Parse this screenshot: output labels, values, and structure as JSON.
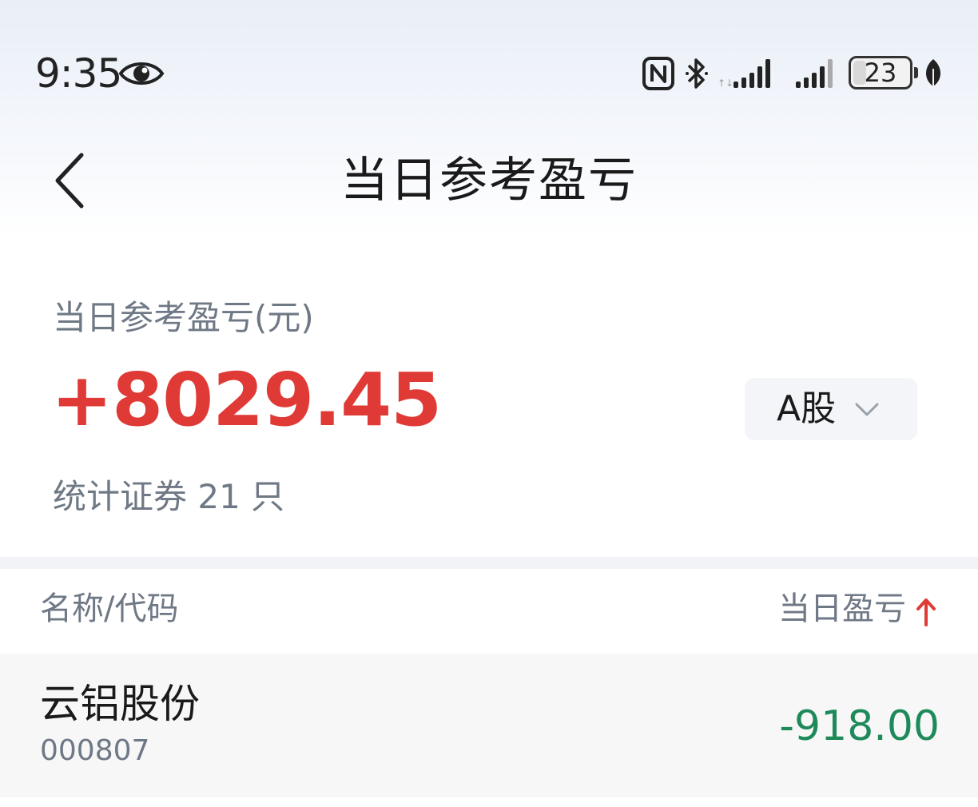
{
  "status_bar": {
    "time": "9:35",
    "battery_level": "23",
    "battery_fraction": 0.23,
    "icons": [
      "eye-icon",
      "nfc-icon",
      "bluetooth-icon",
      "signal-icon",
      "signal-icon",
      "battery-icon",
      "leaf-icon"
    ]
  },
  "nav": {
    "title": "当日参考盈亏",
    "back_icon": "chevron-left-icon"
  },
  "summary": {
    "label": "当日参考盈亏(元)",
    "value": "+8029.45",
    "market_selector": "A股",
    "securities_count": "统计证券 21 只"
  },
  "table": {
    "headers": {
      "name_code": "名称/代码",
      "daily_pnl": "当日盈亏"
    },
    "sort": "ascending",
    "rows": [
      {
        "name": "云铝股份",
        "code": "000807",
        "pnl": "-918.00"
      }
    ]
  },
  "colors": {
    "profit_red": "#e03a36",
    "loss_green": "#1e8a5a",
    "muted_text": "#6f7885",
    "sort_arrow": "#e03a36"
  }
}
